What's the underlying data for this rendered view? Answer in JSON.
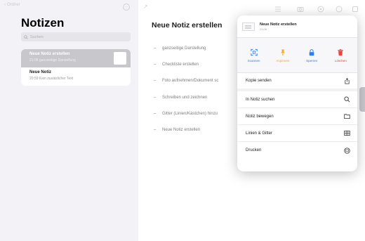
{
  "sidebar": {
    "back_label": "Ordner",
    "title": "Notizen",
    "search_placeholder": "Suchen",
    "notes": [
      {
        "title": "Neue Notiz erstellen",
        "subtitle": "21:06 ganzseitige Darstellung"
      },
      {
        "title": "Neue Notiz",
        "subtitle": "20:59 Kein zusätzlicher Text"
      }
    ]
  },
  "main": {
    "title": "Neue Notiz erstellen",
    "lines": [
      "ganzseitige Darstellung",
      "Checkliste erstellen",
      "Foto aufnehmen/Dokument sc",
      "Schreiben und zeichnen",
      "Gitter (Linien/Kästchen) hinzu",
      "Neue Notiz erstellen"
    ]
  },
  "popover": {
    "note_title": "Neue Notiz erstellen",
    "note_time": "21:06",
    "actions": [
      {
        "label": "Scannen",
        "icon": "scan-icon",
        "color": "#2f7bf5"
      },
      {
        "label": "Anpinnen",
        "icon": "pin-icon",
        "color": "#f3a72c"
      },
      {
        "label": "Sperren",
        "icon": "lock-icon",
        "color": "#2f7bf5"
      },
      {
        "label": "Löschen",
        "icon": "trash-icon",
        "color": "#e8453c"
      }
    ],
    "menu": [
      {
        "label": "Kopie senden",
        "icon": "share-icon"
      },
      {
        "label": "In Notiz suchen",
        "icon": "search-icon"
      },
      {
        "label": "Notiz bewegen",
        "icon": "folder-icon"
      },
      {
        "label": "Linien & Gitter",
        "icon": "grid-icon"
      },
      {
        "label": "Drucken",
        "icon": "print-icon"
      }
    ]
  }
}
